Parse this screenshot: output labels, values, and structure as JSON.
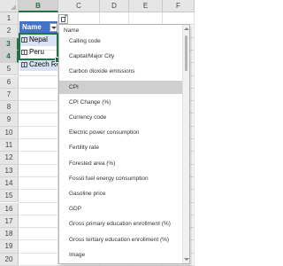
{
  "spreadsheet": {
    "columns": [
      "A",
      "B",
      "C",
      "D",
      "E",
      "F"
    ],
    "selected_column": "B",
    "rows": [
      "1",
      "2",
      "3",
      "4",
      "5",
      "6",
      "7",
      "8",
      "9",
      "10",
      "11",
      "12",
      "13",
      "14",
      "15",
      "16",
      "17",
      "18",
      "19",
      "20"
    ],
    "selected_rows": [
      "3",
      "4"
    ],
    "table": {
      "header": "Name",
      "values": [
        "Nepal",
        "Peru",
        "Czech Re..."
      ]
    }
  },
  "field_picker": {
    "title": "Name",
    "selected": "CPI",
    "fields": [
      "Calling code",
      "Capital/Major City",
      "Carbon dioxide emissions",
      "CPI",
      "CPI Change (%)",
      "Currency code",
      "Electric power consumption",
      "Fertility rate",
      "Forested area (%)",
      "Fossil fuel energy consumption",
      "Gasoline price",
      "GDP",
      "Gross primary education enrollment (%)",
      "Gross tertiary education enrollment (%)",
      "Image"
    ]
  },
  "icons": {
    "corner": "select-all-icon",
    "insert_data": "insert-data-icon",
    "filter": "filter-dropdown-icon",
    "linked_data": "map-geography-icon"
  },
  "colors": {
    "table_header": "#4472c4",
    "table_band": "#d9e1f2",
    "selection": "#217346",
    "highlight": "#cfcfcf"
  }
}
